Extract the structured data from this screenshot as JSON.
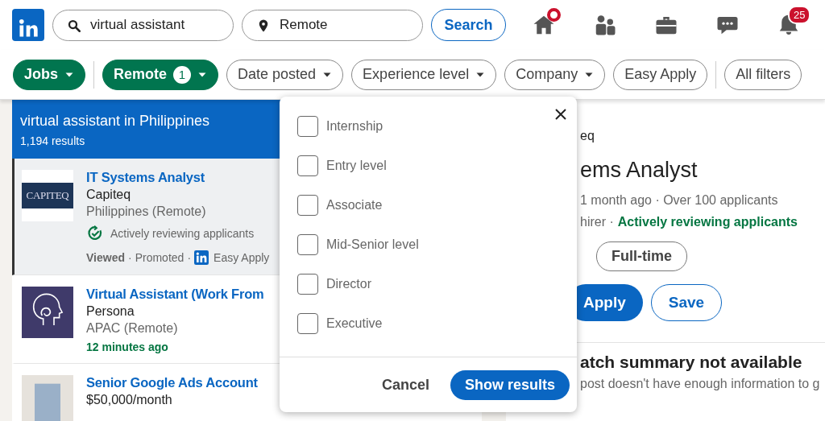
{
  "nav": {
    "search": {
      "value": "virtual assistant"
    },
    "location": {
      "value": "Remote"
    },
    "search_button": "Search",
    "icons": [
      {
        "kind": "home",
        "dot": true
      },
      {
        "kind": "people",
        "dot": false
      },
      {
        "kind": "briefcase",
        "dot": false
      },
      {
        "kind": "chat",
        "dot": false
      },
      {
        "kind": "bell",
        "dot": false,
        "badge": "25"
      }
    ]
  },
  "filters": [
    {
      "label": "Jobs",
      "selected": true,
      "caret": true,
      "divider_after": true
    },
    {
      "label": "Remote",
      "selected": true,
      "count": "1",
      "caret": true,
      "divider_after": false
    },
    {
      "label": "Date posted",
      "selected": false,
      "caret": true,
      "divider_after": false
    },
    {
      "label": "Experience level",
      "selected": false,
      "caret": true,
      "divider_after": false
    },
    {
      "label": "Company",
      "selected": false,
      "caret": true,
      "divider_after": false
    },
    {
      "label": "Easy Apply",
      "selected": false,
      "caret": false,
      "divider_after": true
    },
    {
      "label": "All filters",
      "selected": false,
      "caret": false,
      "divider_after": false
    }
  ],
  "results": {
    "title": "virtual assistant in Philippines",
    "count": "1,194 results"
  },
  "jobs": [
    {
      "selected": true,
      "logo": {
        "kind": "wordmark",
        "text": "CAPITEQ"
      },
      "title": "IT Systems Analyst",
      "company": "Capiteq",
      "location": "Philippines (Remote)",
      "insight": "Actively reviewing applicants",
      "separator": "·",
      "footer": [
        {
          "text": "Viewed",
          "kind": "strong"
        },
        {
          "text": "Promoted",
          "kind": "plain"
        },
        {
          "text": "Easy Apply",
          "kind": "easy"
        }
      ]
    },
    {
      "selected": false,
      "logo": {
        "kind": "head"
      },
      "title": "Virtual Assistant (Work From",
      "company": "Persona",
      "location": "APAC (Remote)",
      "posted": "12 minutes ago"
    },
    {
      "selected": false,
      "logo": {
        "kind": "block"
      },
      "title": "Senior Google Ads Account",
      "company": "$50,000/month"
    }
  ],
  "experience_dropdown": {
    "options": [
      {
        "label": "Internship",
        "checked": false
      },
      {
        "label": "Entry level",
        "checked": false
      },
      {
        "label": "Associate",
        "checked": false
      },
      {
        "label": "Mid-Senior level",
        "checked": false
      },
      {
        "label": "Director",
        "checked": false
      },
      {
        "label": "Executive",
        "checked": false
      }
    ],
    "cancel": "Cancel",
    "submit": "Show results"
  },
  "detail": {
    "company": "eq",
    "title": "ems Analyst",
    "meta": "1 month ago · Over 100 applicants",
    "hirer": "hirer ·",
    "status": "Actively reviewing applicants",
    "chips": [
      "Full-time"
    ],
    "buttons": [
      {
        "label": "Apply",
        "kind": "primary"
      },
      {
        "label": "Save",
        "kind": "secondary"
      }
    ],
    "summary_title": "atch summary not available",
    "summary_text": "post doesn't have enough information to g"
  }
}
